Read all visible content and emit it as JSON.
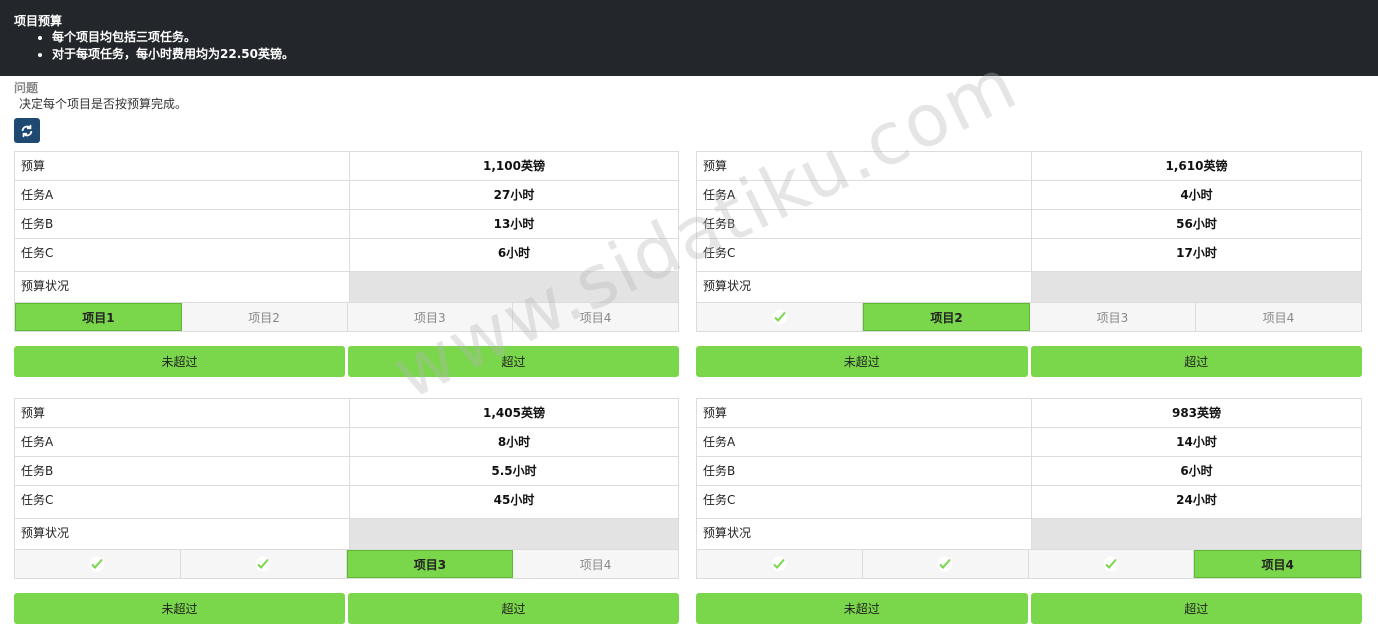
{
  "header": {
    "title": "项目预算",
    "bullets": [
      "每个项目均包括三项任务。",
      "对于每项任务，每小时费用均为22.50英镑。"
    ]
  },
  "question": {
    "label": "问题",
    "text": "决定每个项目是否按预算完成。"
  },
  "watermark": "www.sidatiku.com",
  "row_labels": {
    "budget": "预算",
    "taskA": "任务A",
    "taskB": "任务B",
    "taskC": "任务C",
    "status": "预算状况"
  },
  "buttons": {
    "not_over": "未超过",
    "over": "超过"
  },
  "tab_labels": [
    "项目1",
    "项目2",
    "项目3",
    "项目4"
  ],
  "projects": [
    {
      "budget": "1,100英镑",
      "taskA": "27小时",
      "taskB": "13小时",
      "taskC": "6小时"
    },
    {
      "budget": "1,610英镑",
      "taskA": "4小时",
      "taskB": "56小时",
      "taskC": "17小时"
    },
    {
      "budget": "1,405英镑",
      "taskA": "8小时",
      "taskB": "5.5小时",
      "taskC": "45小时"
    },
    {
      "budget": "983英镑",
      "taskA": "14小时",
      "taskB": "6小时",
      "taskC": "24小时"
    }
  ],
  "colors": {
    "accent": "#7ad64a",
    "header_bg": "#23272b",
    "refresh_bg": "#1e4a72",
    "status_cell": "#e3e3e3"
  }
}
